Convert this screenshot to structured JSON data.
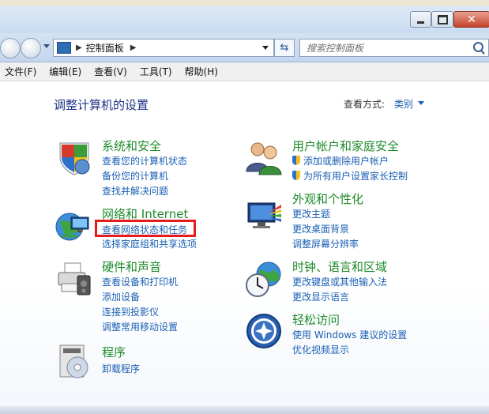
{
  "window": {
    "address_path": "控制面板",
    "search_placeholder": "搜索控制面板"
  },
  "menu": [
    "文件(F)",
    "编辑(E)",
    "查看(V)",
    "工具(T)",
    "帮助(H)"
  ],
  "page": {
    "title": "调整计算机的设置",
    "view_by_label": "查看方式:",
    "view_by_value": "类别"
  },
  "categories": {
    "system": {
      "title": "系统和安全",
      "links": [
        "查看您的计算机状态",
        "备份您的计算机",
        "查找并解决问题"
      ]
    },
    "network": {
      "title": "网络和 Internet",
      "links": [
        "查看网络状态和任务",
        "选择家庭组和共享选项"
      ]
    },
    "hardware": {
      "title": "硬件和声音",
      "links": [
        "查看设备和打印机",
        "添加设备",
        "连接到投影仪",
        "调整常用移动设置"
      ]
    },
    "programs": {
      "title": "程序",
      "links": [
        "卸载程序"
      ]
    },
    "users": {
      "title": "用户帐户和家庭安全",
      "links": [
        "添加或删除用户帐户",
        "为所有用户设置家长控制"
      ]
    },
    "appearance": {
      "title": "外观和个性化",
      "links": [
        "更改主题",
        "更改桌面背景",
        "调整屏幕分辨率"
      ]
    },
    "clock": {
      "title": "时钟、语言和区域",
      "links": [
        "更改键盘或其他输入法",
        "更改显示语言"
      ]
    },
    "ease": {
      "title": "轻松访问",
      "links": [
        "使用 Windows 建议的设置",
        "优化视频显示"
      ]
    }
  },
  "colors": {
    "category_title": "#1e8a2b",
    "link": "#1a5fb4",
    "heading": "#1e3287",
    "highlight": "#e31d1d"
  }
}
